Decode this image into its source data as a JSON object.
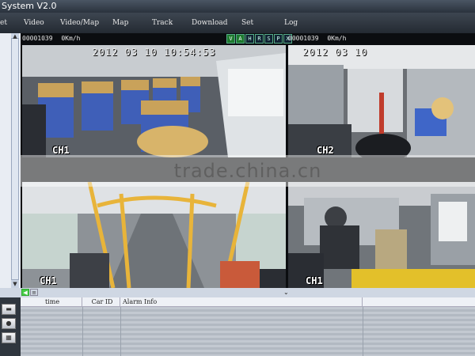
{
  "app": {
    "title": "System V2.0"
  },
  "menu": [
    {
      "label": "et"
    },
    {
      "label": "Video"
    },
    {
      "label": "Video/Map"
    },
    {
      "label": "Map"
    },
    {
      "label": "Track"
    },
    {
      "label": "Download"
    },
    {
      "label": "Set"
    },
    {
      "label": "Log"
    }
  ],
  "video": {
    "left_header": {
      "id": "00001039",
      "speed": "0Km/h"
    },
    "right_header": {
      "id": "00001039",
      "speed": "0Km/h"
    },
    "status_flags": [
      "V",
      "A",
      "H",
      "R",
      "S",
      "P",
      "X"
    ],
    "tiles": [
      {
        "timestamp": "2012 03 10 10:54:53",
        "channel": "CH1"
      },
      {
        "timestamp": "2012 03 10",
        "channel": "CH2"
      },
      {
        "timestamp": "",
        "channel": "CH1"
      },
      {
        "timestamp": "",
        "channel": "CH1"
      }
    ]
  },
  "watermark": "trade.china.cn",
  "alarm_table": {
    "columns": [
      "time",
      "Car ID",
      "Alarm Info"
    ]
  },
  "colors": {
    "accent": "#1e7a2e",
    "background": "#2b3138"
  }
}
